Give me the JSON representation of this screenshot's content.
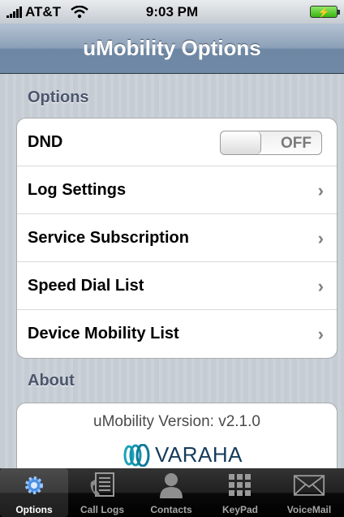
{
  "status_bar": {
    "carrier": "AT&T",
    "time": "9:03 PM"
  },
  "nav": {
    "title": "uMobility Options"
  },
  "options": {
    "header": "Options",
    "dnd": {
      "label": "DND",
      "state": "OFF"
    },
    "items": [
      {
        "label": "Log Settings"
      },
      {
        "label": "Service Subscription"
      },
      {
        "label": "Speed Dial List"
      },
      {
        "label": "Device Mobility List"
      }
    ]
  },
  "about": {
    "header": "About",
    "version": "uMobility Version: v2.1.0",
    "logo_text": "VARAHA"
  },
  "tabs": [
    {
      "label": "Options",
      "icon": "gear-icon",
      "active": true
    },
    {
      "label": "Call Logs",
      "icon": "call-logs-icon",
      "active": false
    },
    {
      "label": "Contacts",
      "icon": "contacts-icon",
      "active": false
    },
    {
      "label": "KeyPad",
      "icon": "keypad-icon",
      "active": false
    },
    {
      "label": "VoiceMail",
      "icon": "voicemail-icon",
      "active": false
    }
  ],
  "colors": {
    "nav_bar": "#6f89a6",
    "section_header": "#4c566c",
    "logo": "#153b5b",
    "active_tab_icon": "#4a90e2"
  }
}
